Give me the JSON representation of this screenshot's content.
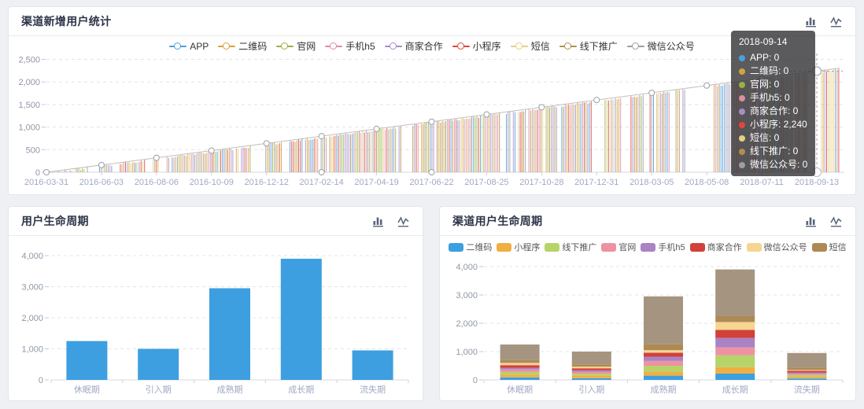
{
  "page_bg": "#eef0f4",
  "cards": {
    "top": {
      "title": "渠道新增用户统计"
    },
    "bottom_left": {
      "title": "用户生命周期"
    },
    "bottom_right": {
      "title": "渠道用户生命周期"
    }
  },
  "header_icon_names": [
    "bar-chart-icon",
    "line-chart-icon"
  ],
  "chart_data": [
    {
      "type": "line",
      "title": "渠道新增用户统计",
      "legend_position": "top",
      "grid": true,
      "series": [
        {
          "name": "APP",
          "color": "#4D9FDC"
        },
        {
          "name": "二维码",
          "color": "#D2A43F"
        },
        {
          "name": "官网",
          "color": "#97B245"
        },
        {
          "name": "手机h5",
          "color": "#DD8CA4"
        },
        {
          "name": "商家合作",
          "color": "#A88CC9"
        },
        {
          "name": "小程序",
          "color": "#E0473B"
        },
        {
          "name": "短信",
          "color": "#E5CF87"
        },
        {
          "name": "线下推广",
          "color": "#B28E4E"
        },
        {
          "name": "微信公众号",
          "color": "#9D9DA3"
        }
      ],
      "x_ticks": [
        "2016-03-31",
        "2016-06-03",
        "2016-08-06",
        "2016-10-09",
        "2016-12-12",
        "2017-02-14",
        "2017-04-19",
        "2017-06-22",
        "2017-08-25",
        "2017-10-28",
        "2017-12-31",
        "2018-03-05",
        "2018-05-08",
        "2018-07-11",
        "2018-09-13"
      ],
      "y_ticks": [
        0,
        500,
        1000,
        1500,
        2000,
        2500
      ],
      "ylim": [
        0,
        2500
      ],
      "pattern": "daily vertical spikes in channel colors rising from 0 to a linearly increasing envelope; each day one channel holds the envelope value and the others are 0",
      "envelope": {
        "x_start": "2016-03-31",
        "x_end": "2018-09-13",
        "y_start": 0,
        "y_end": 2240
      },
      "envelope_values_at_ticks": [
        0,
        160,
        320,
        480,
        640,
        800,
        960,
        1120,
        1280,
        1440,
        1600,
        1760,
        1920,
        2080,
        2240
      ],
      "tooltip": {
        "date": "2018-09-14",
        "rows": [
          {
            "name": "APP",
            "value": "0"
          },
          {
            "name": "二维码",
            "value": "0"
          },
          {
            "name": "官网",
            "value": "0"
          },
          {
            "name": "手机h5",
            "value": "0"
          },
          {
            "name": "商家合作",
            "value": "0"
          },
          {
            "name": "小程序",
            "value": "2,240"
          },
          {
            "name": "短信",
            "value": "0"
          },
          {
            "name": "线下推广",
            "value": "0"
          },
          {
            "name": "微信公众号",
            "value": "0"
          }
        ]
      }
    },
    {
      "type": "bar",
      "title": "用户生命周期",
      "categories": [
        "休眠期",
        "引入期",
        "成熟期",
        "成长期",
        "流失期"
      ],
      "values": [
        1250,
        1000,
        2950,
        3900,
        950
      ],
      "bar_color": "#3D9FE0",
      "y_ticks": [
        0,
        1000,
        2000,
        3000,
        4000
      ],
      "ylim": [
        0,
        4000
      ],
      "grid": true
    },
    {
      "type": "stacked-bar",
      "title": "渠道用户生命周期",
      "legend_position": "top",
      "categories": [
        "休眠期",
        "引入期",
        "成熟期",
        "成长期",
        "流失期"
      ],
      "series": [
        {
          "name": "二维码",
          "color": "#3D9FE0",
          "values": [
            90,
            60,
            150,
            224,
            50
          ]
        },
        {
          "name": "小程序",
          "color": "#EFB041",
          "values": [
            100,
            90,
            150,
            224,
            60
          ]
        },
        {
          "name": "线下推广",
          "color": "#B5D469",
          "values": [
            90,
            70,
            200,
            420,
            60
          ]
        },
        {
          "name": "官网",
          "color": "#EE92A2",
          "values": [
            90,
            70,
            170,
            280,
            50
          ]
        },
        {
          "name": "手机h5",
          "color": "#A983C4",
          "values": [
            60,
            50,
            150,
            336,
            40
          ]
        },
        {
          "name": "商家合作",
          "color": "#D2403A",
          "values": [
            90,
            70,
            140,
            280,
            60
          ]
        },
        {
          "name": "微信公众号",
          "color": "#F6D491",
          "values": [
            80,
            60,
            90,
            280,
            30
          ]
        },
        {
          "name": "短信",
          "color": "#AD8A55",
          "color_top": "#A49480",
          "values": [
            650,
            530,
            1900,
            1856,
            600
          ]
        }
      ],
      "y_ticks": [
        0,
        1000,
        2000,
        3000,
        4000
      ],
      "ylim": [
        0,
        4000
      ],
      "grid": true
    }
  ]
}
